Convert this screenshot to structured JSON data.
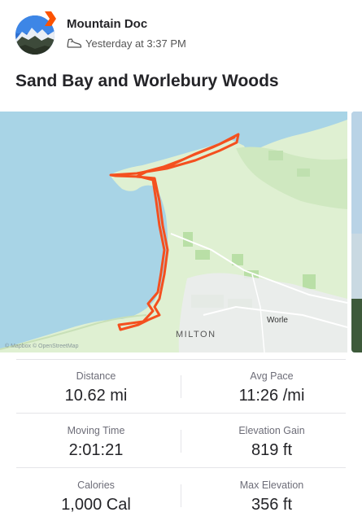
{
  "athlete": {
    "name": "Mountain Doc",
    "timestamp": "Yesterday at 3:37 PM",
    "avatar_icon": "mountain-photo-avatar",
    "sport_icon": "shoe-icon"
  },
  "activity": {
    "title": "Sand Bay and Worlebury Woods"
  },
  "map": {
    "place_labels": [
      "Worle",
      "MILTON"
    ],
    "attribution": "© Mapbox © OpenStreetMap",
    "route_color": "#f4501f",
    "sea_color": "#a8d4e6",
    "land_color": "#dff0d2"
  },
  "stats": [
    {
      "label": "Distance",
      "value": "10.62 mi"
    },
    {
      "label": "Avg Pace",
      "value": "11:26 /mi"
    },
    {
      "label": "Moving Time",
      "value": "2:01:21"
    },
    {
      "label": "Elevation Gain",
      "value": "819 ft"
    },
    {
      "label": "Calories",
      "value": "1,000 Cal"
    },
    {
      "label": "Max Elevation",
      "value": "356 ft"
    }
  ],
  "brand": {
    "accent": "#fc5200"
  }
}
